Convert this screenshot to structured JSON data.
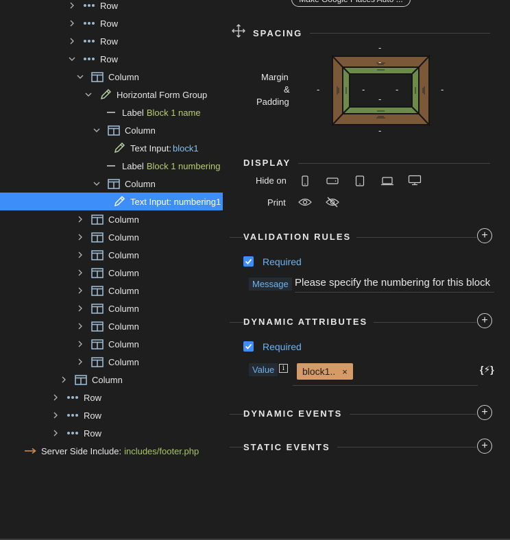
{
  "tree": {
    "rows": [
      {
        "label": "Row"
      },
      {
        "label": "Row"
      },
      {
        "label": "Row"
      },
      {
        "label": "Row"
      },
      {
        "label": "Column"
      },
      {
        "label": "Horizontal Form Group"
      },
      {
        "label": "Label",
        "sub": "Block 1 name"
      },
      {
        "label": "Column"
      },
      {
        "label": "Text Input:",
        "sub": "block1"
      },
      {
        "label": "Label",
        "sub": "Block 1 numbering"
      },
      {
        "label": "Column"
      },
      {
        "label": "Text Input: numbering1"
      },
      {
        "label": "Column"
      },
      {
        "label": "Column"
      },
      {
        "label": "Column"
      },
      {
        "label": "Column"
      },
      {
        "label": "Column"
      },
      {
        "label": "Column"
      },
      {
        "label": "Column"
      },
      {
        "label": "Column"
      },
      {
        "label": "Column"
      },
      {
        "label": "Column"
      },
      {
        "label": "Row"
      },
      {
        "label": "Row"
      },
      {
        "label": "Row"
      },
      {
        "label": "Server Side Include:",
        "sub": "includes/footer.php"
      }
    ]
  },
  "panel": {
    "top_button": "Make Google Places Auto ...",
    "spacing": {
      "title": "SPACING",
      "label_margin": "Margin",
      "label_amp": "&",
      "label_padding": "Padding",
      "margin_top": "-",
      "margin_bottom": "-",
      "margin_left": "-",
      "margin_right": "-",
      "padding_top": "-",
      "padding_bottom": "-",
      "padding_left": "-",
      "padding_right": "-",
      "margin_color": "#7a5838",
      "padding_color": "#6c8a4a"
    },
    "display": {
      "title": "DISPLAY",
      "hide_on": "Hide on",
      "print": "Print"
    },
    "validation": {
      "title": "VALIDATION RULES",
      "required": "Required",
      "message_label": "Message",
      "message_value": "Please specify the numbering for this block"
    },
    "dynamic_attributes": {
      "title": "DYNAMIC ATTRIBUTES",
      "required": "Required",
      "value_label": "Value",
      "info_icon": "i",
      "chip": "block1..",
      "chip_close": "×",
      "dynamic_icon": "{⚡}"
    },
    "dynamic_events": {
      "title": "DYNAMIC EVENTS"
    },
    "static_events": {
      "title": "STATIC EVENTS"
    }
  },
  "colors": {
    "accent": "#3d8ef8",
    "label_green": "#a6c468",
    "link_blue": "#6fb3ee",
    "chip_bg": "#d59a66"
  }
}
